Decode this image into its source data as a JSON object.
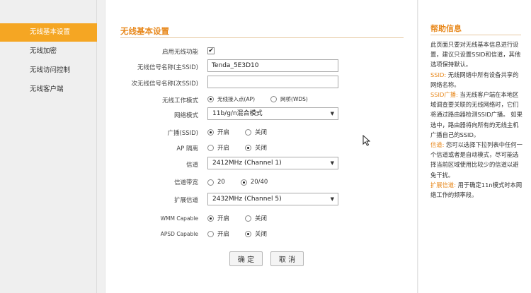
{
  "sidebar": {
    "items": [
      {
        "label": "无线基本设置",
        "active": true
      },
      {
        "label": "无线加密"
      },
      {
        "label": "无线访问控制"
      },
      {
        "label": "无线客户端"
      }
    ]
  },
  "main": {
    "title": "无线基本设置",
    "enable_label": "启用无线功能",
    "enable_checked": "✔",
    "ssid_label": "无线信号名称(主SSID)",
    "ssid_value": "Tenda_5E3D10",
    "ssid2_label": "次无线信号名称(次SSID)",
    "ssid2_value": "",
    "mode_label": "无线工作模式",
    "mode_opt1": "无线接入点(AP)",
    "mode_opt2": "网桥(WDS)",
    "netmode_label": "网络模式",
    "netmode_value": "11b/g/n混合模式",
    "broadcast_label": "广播(SSID)",
    "broadcast_on": "开启",
    "broadcast_off": "关闭",
    "ap_label": "AP 隔离",
    "ap_on": "开启",
    "ap_off": "关闭",
    "channel_label": "信道",
    "channel_value": "2412MHz (Channel 1)",
    "bandwidth_label": "信道带宽",
    "bw_opt1": "20",
    "bw_opt2": "20/40",
    "ext_label": "扩展信道",
    "ext_value": "2432MHz (Channel 5)",
    "wmm_label": "WMM Capable",
    "wmm_on": "开启",
    "wmm_off": "关闭",
    "apsd_label": "APSD Capable",
    "apsd_on": "开启",
    "apsd_off": "关闭",
    "ok_label": "确 定",
    "cancel_label": "取 消"
  },
  "help": {
    "title": "帮助信息",
    "intro": "此页面只要对无线基本信息进行设置，建议只设置SSID和信道，其他选项保持默认。",
    "ssid_key": "SSID:",
    "ssid_text": " 无线网络中所有设备共享的网络名称。",
    "bcast_key": "SSID广播:",
    "bcast_text": " 当无线客户端在本地区域调查要关联的无线网络时，它们将通过路由器检测SSID广播。 如果选中，路由器将向所有的无线主机广播自己的SSID。",
    "chan_key": "信道:",
    "chan_text": " 您可以选择下拉列表中任何一个信道或者是自动模式，尽可能选择当前区域使用比较少的信道以避免干扰。",
    "ext_key": "扩展信道:",
    "ext_text": " 用于确定11n模式时本网络工作的频率段。"
  },
  "colors": {
    "accent": "#f5a623",
    "title_orange": "#e8891d"
  }
}
